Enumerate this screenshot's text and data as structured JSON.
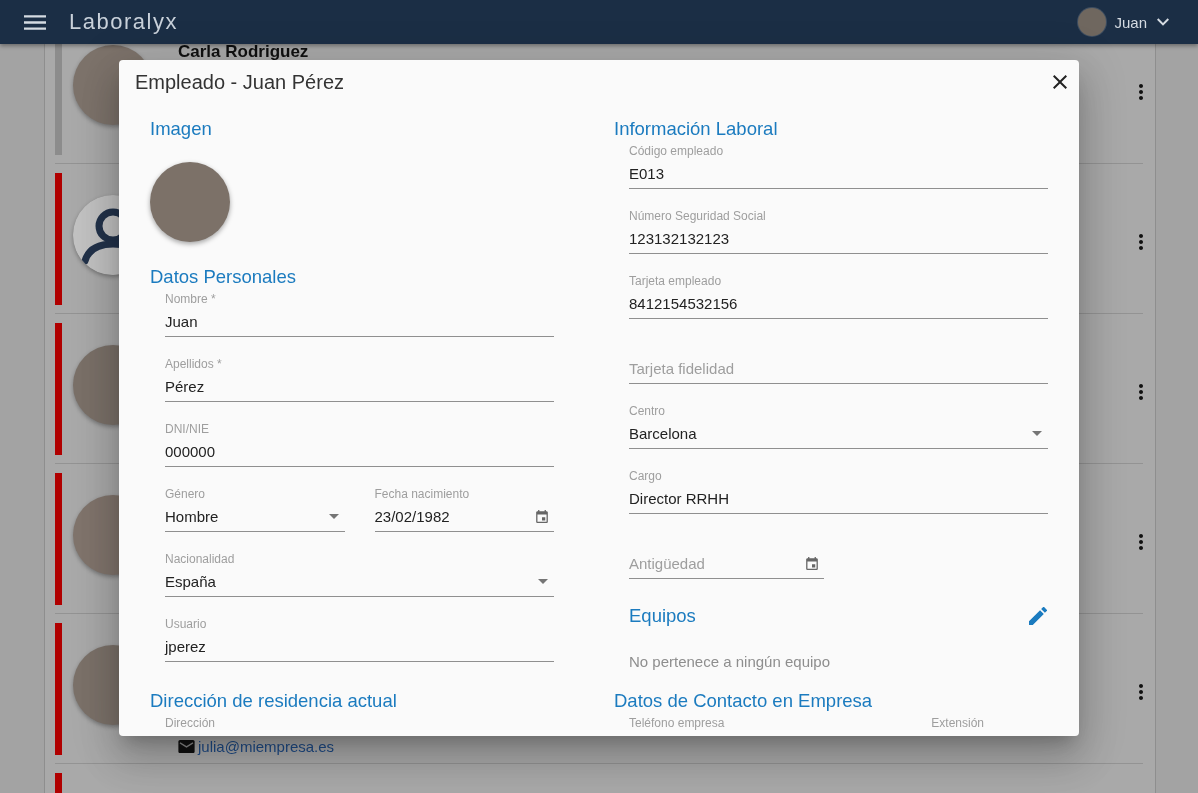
{
  "app_bar": {
    "title": "Laboralyx",
    "user": {
      "name": "Juan"
    }
  },
  "employee_list": {
    "rows": [
      {
        "kind": "photo",
        "color": "#8c8c8c",
        "name": "Carla Rodriguez"
      },
      {
        "kind": "generic",
        "color": "#b00000"
      },
      {
        "kind": "photo",
        "color": "#b00000"
      },
      {
        "kind": "photo",
        "color": "#b00000"
      },
      {
        "kind": "photo",
        "color": "#b00000",
        "email": "julia@miempresa.es"
      },
      {
        "kind": "clipped",
        "color": "#b00000"
      }
    ]
  },
  "dialog": {
    "title": "Empleado - Juan Pérez",
    "columns": [
      [
        {
          "kind": "image",
          "heading": "Imagen"
        },
        {
          "kind": "fields",
          "heading": "Datos Personales",
          "rows": [
            [
              {
                "kind": "text",
                "label": "Nombre *",
                "value": "Juan"
              }
            ],
            [
              {
                "kind": "text",
                "label": "Apellidos *",
                "value": "Pérez"
              }
            ],
            [
              {
                "kind": "text",
                "label": "DNI/NIE",
                "value": "000000"
              }
            ],
            [
              {
                "kind": "select",
                "label": "Género",
                "value": "Hombre"
              },
              {
                "kind": "date",
                "label": "Fecha nacimiento",
                "value": "23/02/1982"
              }
            ],
            [
              {
                "kind": "select",
                "label": "Nacionalidad",
                "value": "España"
              }
            ],
            [
              {
                "kind": "text",
                "label": "Usuario",
                "value": "jperez"
              }
            ]
          ]
        },
        {
          "kind": "fields",
          "heading": "Dirección de residencia actual",
          "rows": [
            [
              {
                "kind": "caption",
                "label": "Dirección"
              }
            ]
          ]
        }
      ],
      [
        {
          "kind": "fields",
          "heading": "Información Laboral",
          "rows": [
            [
              {
                "kind": "text",
                "label": "Código empleado",
                "value": "E013"
              }
            ],
            [
              {
                "kind": "text",
                "label": "Número Seguridad Social",
                "value": "123132132123"
              }
            ],
            [
              {
                "kind": "text",
                "label": "Tarjeta empleado",
                "value": "8412154532156"
              }
            ],
            [
              {
                "kind": "text",
                "placeholder": "Tarjeta fidelidad"
              }
            ],
            [
              {
                "kind": "select",
                "label": "Centro",
                "value": "Barcelona"
              }
            ],
            [
              {
                "kind": "text",
                "label": "Cargo",
                "value": "Director RRHH"
              }
            ],
            [
              {
                "kind": "date",
                "placeholder": "Antigüedad"
              }
            ]
          ]
        },
        {
          "kind": "team",
          "heading": "Equipos",
          "empty_text": "No pertenece a ningún equipo"
        },
        {
          "kind": "fields",
          "heading": "Datos de Contacto en Empresa",
          "rows": [
            [
              {
                "kind": "caption",
                "label": "Teléfono empresa"
              },
              {
                "kind": "caption",
                "label": "Extensión"
              }
            ]
          ]
        }
      ]
    ]
  }
}
